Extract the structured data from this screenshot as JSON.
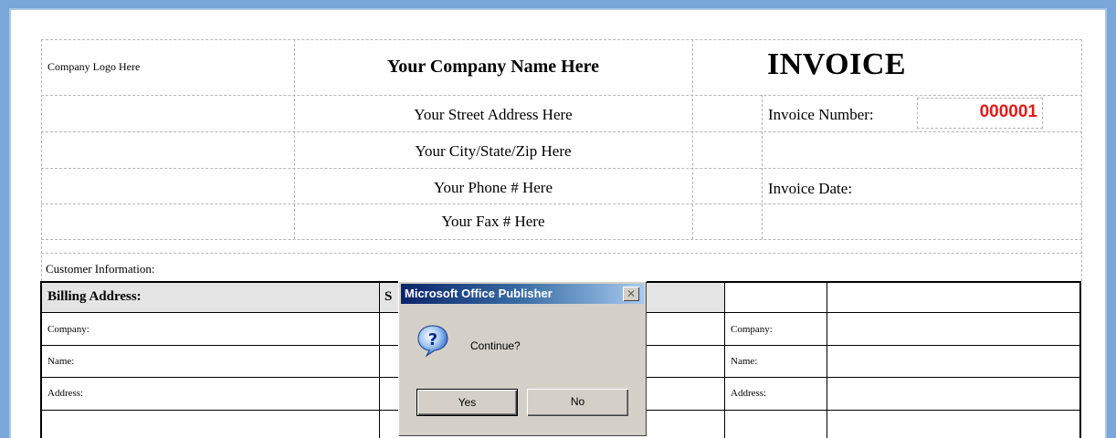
{
  "invoice": {
    "logo_placeholder": "Company Logo Here",
    "company_name": "Your Company Name Here",
    "title": "INVOICE",
    "street": "Your Street Address Here",
    "city_state_zip": "Your City/State/Zip Here",
    "phone": "Your Phone # Here",
    "fax": "Your Fax # Here",
    "invoice_number_label": "Invoice Number:",
    "invoice_number": "000001",
    "invoice_date_label": "Invoice Date:"
  },
  "customer": {
    "section_label": "Customer Information:",
    "billing_header": "Billing Address:",
    "shipping_header_visible": "S",
    "left_rows": [
      "Company:",
      "Name:",
      "Address:"
    ],
    "right_rows": [
      "Company:",
      "Name:",
      "Address:"
    ]
  },
  "dialog": {
    "title": "Microsoft Office Publisher",
    "close_glyph": "✕",
    "message": "Continue?",
    "yes_label": "Yes",
    "no_label": "No",
    "icon": "question-icon"
  },
  "colors": {
    "invoice_number": "#e21b1b",
    "window_frame": "#7aa7d9",
    "dialog_title_start": "#0a246a",
    "dialog_face": "#d4d0c8"
  }
}
